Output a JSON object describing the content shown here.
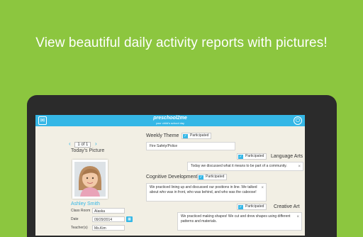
{
  "headline": "View beautiful daily activity reports with pictures!",
  "colors": {
    "background": "#8cc63f",
    "accent": "#35b7e6"
  },
  "appbar": {
    "brand": "preschool2me",
    "tagline": "your child's school day",
    "left_icon": "message-icon",
    "right_icon": "power-icon"
  },
  "pager": {
    "prev": "‹",
    "page": "1",
    "of": "of 1",
    "next": "›"
  },
  "left_panel": {
    "title": "Today's Picture",
    "child_name": "Ashley Smith",
    "fields": [
      {
        "label": "Class Room",
        "value": "Alaska"
      },
      {
        "label": "Date",
        "value": "09/29/2014"
      },
      {
        "label": "Teacher(s)",
        "value": "Ms.Kim"
      }
    ]
  },
  "activities": [
    {
      "title": "Weekly Theme",
      "status": "Participated",
      "note": "Fire Safety/Police"
    },
    {
      "title": "Language Arts",
      "status": "Participated",
      "note": "Today we discussed what it means to be part of a community."
    },
    {
      "title": "Cognitive Development",
      "status": "Participated",
      "note": "We practiced lining up and discussed our positions in line. We talked about who was in front, who was behind, and who was the caboose!"
    },
    {
      "title": "Creative Art",
      "status": "Participated",
      "note": "We practiced making shapes! We cut and drew shapes using different patterns and materials."
    }
  ]
}
